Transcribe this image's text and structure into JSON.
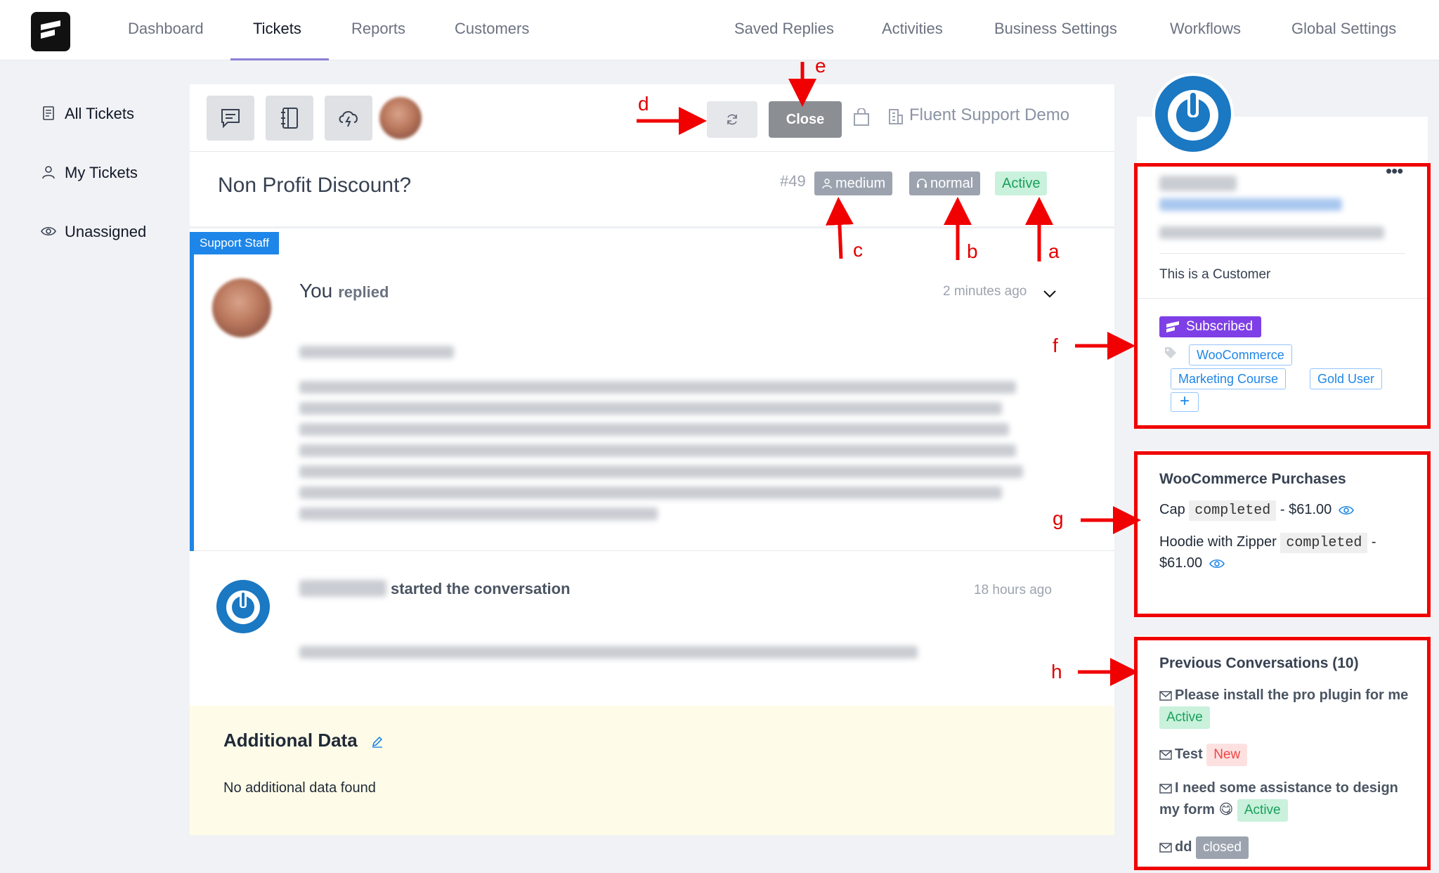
{
  "nav": {
    "items": [
      "Dashboard",
      "Tickets",
      "Reports",
      "Customers",
      "Saved Replies",
      "Activities",
      "Business Settings",
      "Workflows",
      "Global Settings"
    ],
    "active": "Tickets"
  },
  "sidebar": {
    "items": [
      {
        "label": "All Tickets",
        "icon": "document-icon"
      },
      {
        "label": "My Tickets",
        "icon": "user-icon"
      },
      {
        "label": "Unassigned",
        "icon": "eye-icon"
      }
    ]
  },
  "toolbar": {
    "close_label": "Close",
    "company": "Fluent Support Demo"
  },
  "ticket": {
    "title": "Non Profit Discount?",
    "id": "#49",
    "priority": "medium",
    "client_priority": "normal",
    "status": "Active"
  },
  "reply": {
    "tag": "Support Staff",
    "author": "You",
    "action": "replied",
    "time": "2 minutes ago"
  },
  "started": {
    "action": "started the conversation",
    "time": "18 hours ago"
  },
  "additional": {
    "title": "Additional Data",
    "empty": "No additional data found"
  },
  "customer": {
    "label": "This is a Customer",
    "subscription": "Subscribed",
    "tags": [
      "WooCommerce",
      "Marketing Course",
      "Gold User"
    ],
    "add_tag": "+"
  },
  "purchases": {
    "title": "WooCommerce Purchases",
    "items": [
      {
        "name": "Cap",
        "status": "completed",
        "amount": "- $61.00"
      },
      {
        "name": "Hoodie with Zipper",
        "status": "completed",
        "amount": "-",
        "amount2": "$61.00"
      }
    ]
  },
  "previous": {
    "title": "Previous Conversations (10)",
    "items": [
      {
        "title": "Please install the pro plugin for me",
        "status": "Active"
      },
      {
        "title": "Test",
        "status": "New"
      },
      {
        "title": "I need some assistance to design my form 😋",
        "status": "Active"
      },
      {
        "title": "dd",
        "status": "closed"
      }
    ]
  },
  "annotations": [
    "a",
    "b",
    "c",
    "d",
    "e",
    "f",
    "g",
    "h"
  ],
  "colors": {
    "accent": "#1e86e8",
    "annotation": "#f00000",
    "subscribed": "#7e3fe6",
    "active_bg": "#c9f1dc",
    "active_text": "#19a05a"
  }
}
